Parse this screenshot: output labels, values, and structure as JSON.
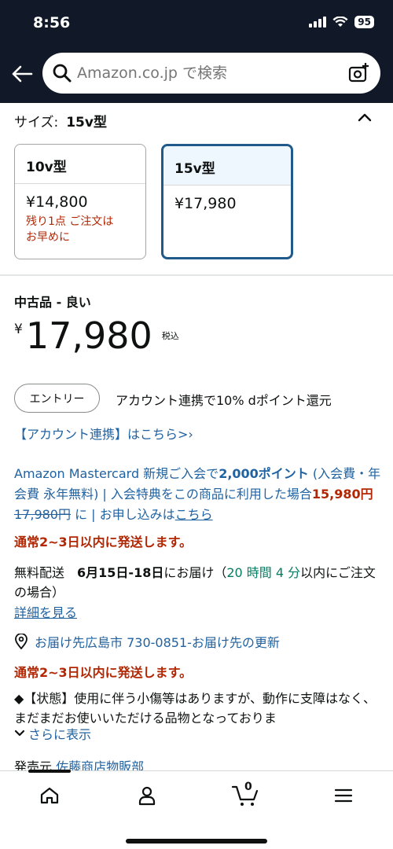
{
  "status_bar": {
    "time": "8:56",
    "battery": "95"
  },
  "search": {
    "placeholder": "Amazon.co.jp で検索"
  },
  "size_selector": {
    "label": "サイズ:",
    "selected": "15v型",
    "options": [
      {
        "name": "10v型",
        "price": "¥14,800",
        "stock_line1": "残り1点 ご注文は",
        "stock_line2": "お早めに"
      },
      {
        "name": "15v型",
        "price": "¥17,980"
      }
    ]
  },
  "offer": {
    "condition": "中古品 - 良い",
    "currency": "¥",
    "price": "17,980",
    "tax_note": "税込",
    "entry_button": "エントリー",
    "entry_text": "アカウント連携で10% dポイント還元",
    "account_link": "【アカウント連携】はこちら>›",
    "mastercard": {
      "part1": "Amazon Mastercard 新規ご入会で",
      "points": "2,000ポイント",
      "part2": " (入会費・年会費 永年無料) | 入会特典をこの商品に利用した場合",
      "discount_price": "15,980円",
      "orig_price": "17,980円",
      "part3": " に | お申し込みは",
      "link": "こちら"
    },
    "ship_notice": "通常2~3日以内に発送します。",
    "delivery": {
      "prefix": "無料配送",
      "date": "6月15日-18日",
      "suffix": "にお届け（",
      "countdown": "20 時間 4 分",
      "tail": "以内にご注文の場合）"
    },
    "details_link": "詳細を見る",
    "location": "お届け先広島市 730-0851‐お届け先の更新",
    "ship_notice_2": "通常2~3日以内に発送します。",
    "condition_desc": "◆【状態】使用に伴う小傷等はありますが、動作に支障はなく、まだまだお使いいただける品物となっておりま",
    "show_more": "さらに表示",
    "seller_label": "発売元",
    "seller_name": "佐藤商店物販部"
  },
  "bottom_nav": {
    "cart_count": "0"
  }
}
